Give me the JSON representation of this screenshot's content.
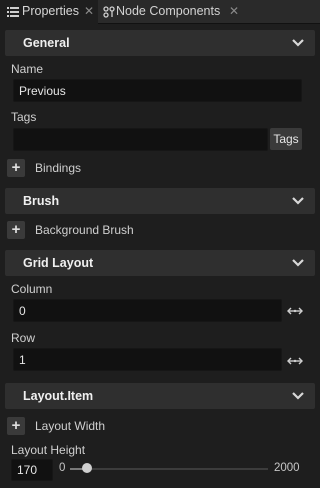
{
  "tabs": [
    {
      "label": "Properties",
      "icon": "list-icon",
      "active": true
    },
    {
      "label": "Node Components",
      "icon": "nodes-icon",
      "active": false
    }
  ],
  "sections": {
    "general": {
      "title": "General",
      "name_label": "Name",
      "name_value": "Previous",
      "tags_label": "Tags",
      "tags_value": "",
      "tags_button": "Tags",
      "bindings_label": "Bindings"
    },
    "brush": {
      "title": "Brush",
      "background_brush_label": "Background Brush"
    },
    "grid_layout": {
      "title": "Grid Layout",
      "column_label": "Column",
      "column_value": "0",
      "row_label": "Row",
      "row_value": "1"
    },
    "layout_item": {
      "title": "Layout.Item",
      "layout_width_label": "Layout Width",
      "layout_height_label": "Layout Height",
      "layout_height_value": "170",
      "slider_min": "0",
      "slider_max": "2000",
      "slider_value": 170
    }
  },
  "colors": {
    "panel_bg": "#1e1e1e",
    "header_bg": "#2f2f2f",
    "input_bg": "#111111",
    "button_bg": "#3a3a3a"
  }
}
